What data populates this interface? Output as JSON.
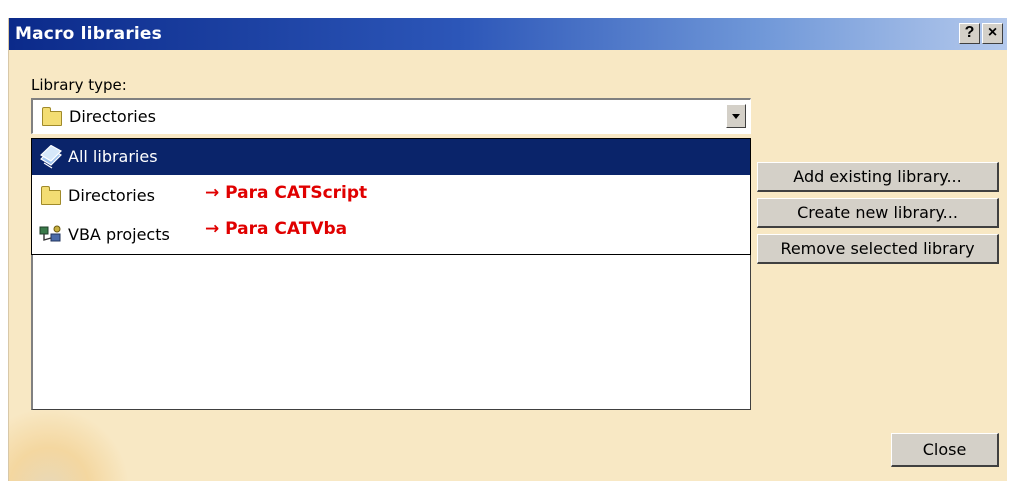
{
  "window": {
    "title": "Macro libraries",
    "help_button": "?",
    "close_button": "×"
  },
  "library_type": {
    "label": "Library type:",
    "selected_value": "Directories",
    "selected_icon": "folder-icon"
  },
  "dropdown": {
    "items": [
      {
        "label": "All libraries",
        "icon": "all-libraries-icon",
        "selected": true,
        "note": ""
      },
      {
        "label": "Directories",
        "icon": "folder-icon",
        "selected": false,
        "note": "→ Para CATScript"
      },
      {
        "label": "VBA projects",
        "icon": "vba-projects-icon",
        "selected": false,
        "note": "→ Para CATVba"
      }
    ]
  },
  "buttons": {
    "add_existing": "Add existing library...",
    "create_new": "Create new library...",
    "remove_selected": "Remove selected library",
    "close": "Close"
  },
  "colors": {
    "title_gradient_start": "#0b2a8a",
    "title_gradient_end": "#b4c9ec",
    "selection": "#0a246a",
    "annotation": "#e00000",
    "dialog_background": "#f8e8c4"
  }
}
